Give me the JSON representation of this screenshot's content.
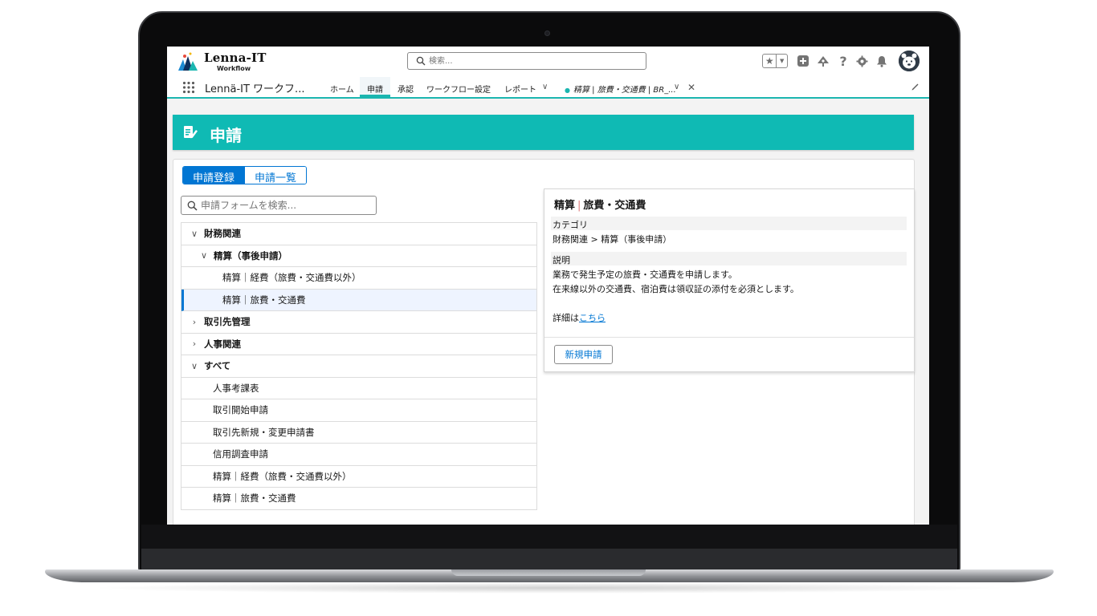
{
  "app": {
    "logo_text": "Lenna-IT",
    "logo_subtitle": "Workflow",
    "search_placeholder": "検索...",
    "name": "Lennä-IT ワークフ..."
  },
  "nav": {
    "items": [
      {
        "label": "ホーム",
        "active": false
      },
      {
        "label": "申請",
        "active": true
      },
      {
        "label": "承認",
        "active": false
      },
      {
        "label": "ワークフロー設定",
        "active": false
      },
      {
        "label": "レポート",
        "active": false
      }
    ],
    "record_tab": "精算 | 旅費・交通費 | BR_..."
  },
  "page": {
    "title": "申請"
  },
  "tabs": {
    "register": "申請登録",
    "list": "申請一覧"
  },
  "form_search": {
    "placeholder": "申請フォームを検索..."
  },
  "tree": {
    "items": [
      {
        "label": "財務関連",
        "level": 0,
        "expanded": true,
        "bold": true
      },
      {
        "label": "精算（事後申請）",
        "level": 1,
        "expanded": true,
        "bold": true
      },
      {
        "label": "精算｜経費（旅費・交通費以外）",
        "level": 2,
        "bold": false
      },
      {
        "label": "精算｜旅費・交通費",
        "level": 2,
        "bold": false,
        "selected": true
      },
      {
        "label": "取引先管理",
        "level": 0,
        "expanded": false,
        "bold": true
      },
      {
        "label": "人事関連",
        "level": 0,
        "expanded": false,
        "bold": true
      },
      {
        "label": "すべて",
        "level": 0,
        "expanded": true,
        "bold": true
      },
      {
        "label": "人事考課表",
        "level": 1,
        "bold": false
      },
      {
        "label": "取引開始申請",
        "level": 1,
        "bold": false
      },
      {
        "label": "取引先新規・変更申請書",
        "level": 1,
        "bold": false
      },
      {
        "label": "信用調査申請",
        "level": 1,
        "bold": false
      },
      {
        "label": "精算｜経費（旅費・交通費以外）",
        "level": 1,
        "bold": false
      },
      {
        "label": "精算｜旅費・交通費",
        "level": 1,
        "bold": false
      }
    ]
  },
  "detail": {
    "title_a": "精算",
    "title_sep": "|",
    "title_b": "旅費・交通費",
    "category_label": "カテゴリ",
    "category_value": "財務関連 > 精算（事後申請）",
    "description_label": "説明",
    "description_line1": "業務で発生予定の旅費・交通費を申請します。",
    "description_line2": "在来線以外の交通費、宿泊費は領収証の添付を必須とします。",
    "details_prefix": "詳細は",
    "details_link": "こちら",
    "new_button": "新規申請"
  },
  "colors": {
    "brand_teal": "#0fbab4",
    "nav_underline": "#1bb6b0",
    "primary_blue": "#0176d3",
    "selected_row": "#eef4ff"
  }
}
